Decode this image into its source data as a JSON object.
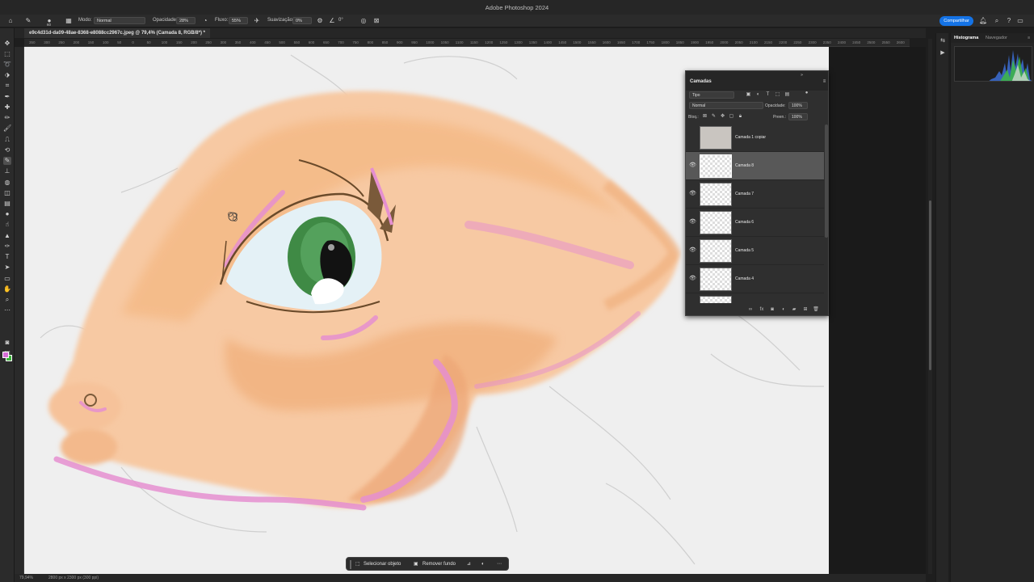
{
  "app": {
    "title": "Adobe Photoshop 2024"
  },
  "options_bar": {
    "mode_label": "Modo:",
    "mode_value": "Normal",
    "opacity_label": "Opacidade:",
    "opacity_value": "28%",
    "flow_label": "Fluxo:",
    "flow_value": "55%",
    "smoothing_label": "Suavização:",
    "smoothing_value": "0%",
    "angle_value": "0°",
    "brush_size": "60",
    "share_label": "Compartilhar"
  },
  "document": {
    "tab_label": "e9c4d31d-da09-48ae-8368-e8088cc2967c.jpeg @ 79,4% (Camada 8, RGB/8*) *"
  },
  "ruler": {
    "top_marks": [
      "350",
      "300",
      "250",
      "200",
      "150",
      "100",
      "50",
      "0",
      "50",
      "100",
      "150",
      "200",
      "250",
      "300",
      "350",
      "400",
      "450",
      "500",
      "550",
      "600",
      "650",
      "700",
      "750",
      "800",
      "850",
      "900",
      "950",
      "1000",
      "1050",
      "1100",
      "1150",
      "1200",
      "1250",
      "1300",
      "1350",
      "1400",
      "1450",
      "1500",
      "1550",
      "1600",
      "1650",
      "1700",
      "1750",
      "1800",
      "1850",
      "1900",
      "1950",
      "2000",
      "2050",
      "2100",
      "2150",
      "2200",
      "2250",
      "2300",
      "2350",
      "2400",
      "2450",
      "2500",
      "2550",
      "2600",
      "2650",
      "2700",
      "2750"
    ]
  },
  "toolbar": {
    "tools": [
      "move-icon",
      "marquee-icon",
      "lasso-icon",
      "object-select-icon",
      "crop-icon",
      "eyedropper-icon",
      "healing-icon",
      "brush-icon",
      "clone-stamp-icon",
      "history-brush-icon",
      "eraser-icon",
      "gradient-icon",
      "blur-icon",
      "dodge-icon",
      "pen-icon",
      "type-icon",
      "path-select-icon",
      "shape-icon",
      "hand-icon",
      "zoom-icon",
      "more-icon"
    ]
  },
  "colors": {
    "foreground": "#d66ed6",
    "background": "#3cb43c",
    "accent": "#1473e6"
  },
  "layers_panel": {
    "title": "Camadas",
    "filter_kind": "Tipo",
    "blend_mode": "Normal",
    "opacity_label": "Opacidade:",
    "opacity_value": "100%",
    "lock_label": "Bloq.:",
    "fill_label": "Preen.:",
    "fill_value": "100%",
    "layers": [
      {
        "name": "Camada 1 copiar",
        "visible": false,
        "selected": false
      },
      {
        "name": "Camada 8",
        "visible": true,
        "selected": true
      },
      {
        "name": "Camada 7",
        "visible": true,
        "selected": false
      },
      {
        "name": "Camada 6",
        "visible": true,
        "selected": false
      },
      {
        "name": "Camada 5",
        "visible": true,
        "selected": false
      },
      {
        "name": "Camada 4",
        "visible": true,
        "selected": false
      }
    ]
  },
  "right_panel": {
    "tabs": [
      "Histograma",
      "Navegador"
    ]
  },
  "taskbar": {
    "select_object": "Selecionar objeto",
    "remove_background": "Remover fundo"
  },
  "status_bar": {
    "zoom": "79,94%",
    "doc_size": "2800 px x 2300 px (300 ppi)"
  }
}
